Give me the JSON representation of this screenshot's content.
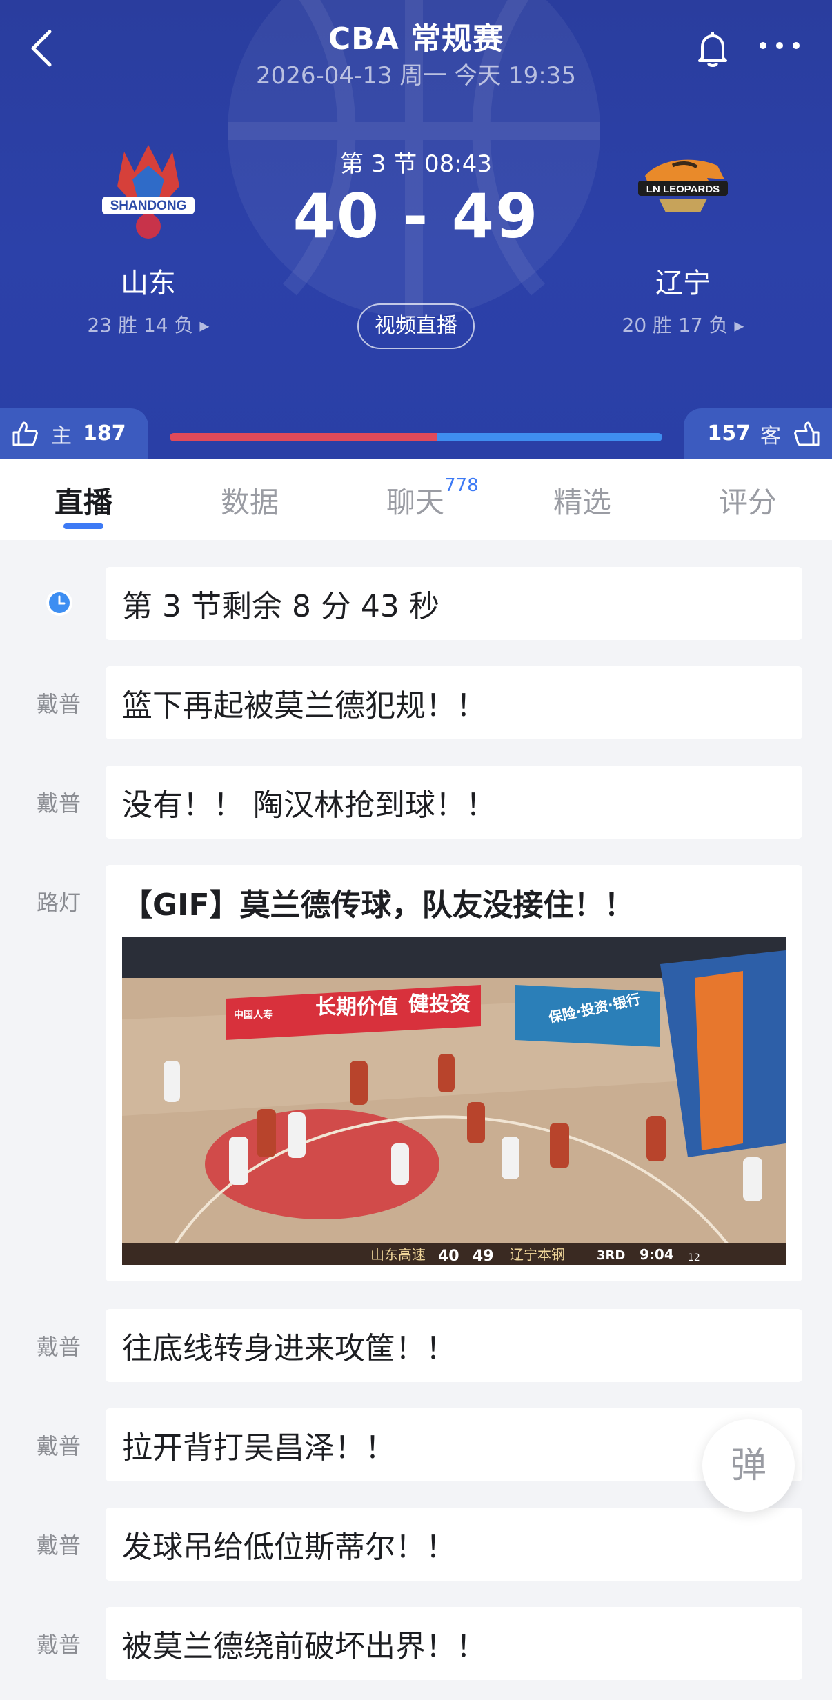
{
  "header": {
    "title": "CBA 常规赛",
    "subtitle": "2026-04-13 周一 今天 19:35",
    "period_clock": "第 3 节 08:43",
    "score": "40 - 49",
    "video_button": "视频直播"
  },
  "home": {
    "name": "山东",
    "record": "23 胜 14 负 ▸",
    "logo_text": "SHANDONG"
  },
  "away": {
    "name": "辽宁",
    "record": "20 胜 17 负 ▸",
    "logo_text": "LN LEOPARDS"
  },
  "likes": {
    "home_label": "主",
    "home_count": "187",
    "away_label": "客",
    "away_count": "157",
    "home_fraction": 0.544
  },
  "tabs": [
    {
      "label": "直播"
    },
    {
      "label": "数据"
    },
    {
      "label": "聊天",
      "badge": "778"
    },
    {
      "label": "精选"
    },
    {
      "label": "评分"
    }
  ],
  "feed": {
    "status": "第 3 节剩余 8 分 43 秒",
    "items": [
      {
        "author": "戴普",
        "text": "篮下再起被莫兰德犯规！！"
      },
      {
        "author": "戴普",
        "text": "没有！！ 陶汉林抢到球！！"
      },
      {
        "author": "路灯",
        "text": "【GIF】莫兰德传球，队友没接住！！"
      },
      {
        "author": "戴普",
        "text": "往底线转身进来攻筐！！"
      },
      {
        "author": "戴普",
        "text": "拉开背打吴昌泽！！"
      },
      {
        "author": "戴普",
        "text": "发球吊给低位斯蒂尔！！"
      },
      {
        "author": "戴普",
        "text": "被莫兰德绕前破坏出界！！"
      }
    ],
    "gif_scoreboard": {
      "home": "山东高速",
      "home_score": "40",
      "away_score": "49",
      "away": "辽宁本钢",
      "period": "3RD",
      "clock": "9:04",
      "shot": "12"
    },
    "gif_ad1": "长期价值",
    "gif_ad2": "健投资",
    "gif_ad3": "保险·投资·银行",
    "gif_ad4": "中国人寿"
  },
  "danmu_button": "弹",
  "colors": {
    "header_bg": "#2c41a9",
    "home_bar": "#e04a5a",
    "away_bar": "#3f8ef0",
    "tab_accent": "#3d7af5"
  }
}
